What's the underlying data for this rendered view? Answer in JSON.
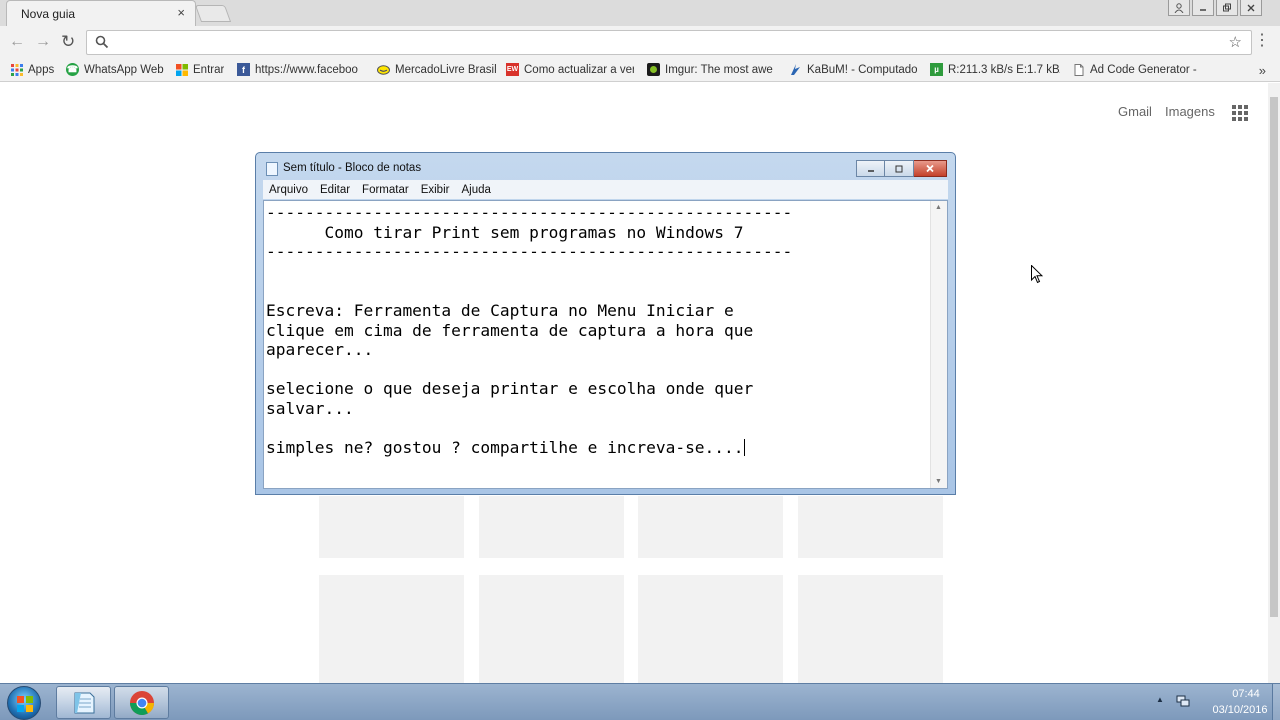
{
  "browser": {
    "tab_title": "Nova guia",
    "tab_close": "×",
    "omnibox_value": "",
    "bookmarks": [
      {
        "label": "Apps",
        "icon": "apps-grid-icon",
        "color": "#e8453c"
      },
      {
        "label": "WhatsApp Web",
        "icon": "whatsapp-icon",
        "color": "#25a244"
      },
      {
        "label": "Entrar",
        "icon": "microsoft-icon",
        "color": "#f25022"
      },
      {
        "label": "https://www.faceboo",
        "icon": "facebook-icon",
        "color": "#3b5998"
      },
      {
        "label": "MercadoLivre Brasil",
        "icon": "mercadolivre-icon",
        "color": "#7a7a7a"
      },
      {
        "label": "Como actualizar a ver",
        "icon": "ew-icon",
        "color": "#d8322b"
      },
      {
        "label": "Imgur: The most awe",
        "icon": "imgur-icon",
        "color": "#1b1b1b"
      },
      {
        "label": "KaBuM! - Computado",
        "icon": "kabum-icon",
        "color": "#2b66b3"
      },
      {
        "label": "R:211.3 kB/s E:1.7 kB/",
        "icon": "utorrent-icon",
        "color": "#2e9b3c"
      },
      {
        "label": "Ad Code Generator -",
        "icon": "page-icon",
        "color": "#888888"
      }
    ],
    "bookmarks_more": "»"
  },
  "newtab": {
    "gmail": "Gmail",
    "images": "Imagens"
  },
  "notepad": {
    "title": "Sem título - Bloco de notas",
    "menu": [
      "Arquivo",
      "Editar",
      "Formatar",
      "Exibir",
      "Ajuda"
    ],
    "lines": [
      "------------------------------------------------------",
      "      Como tirar Print sem programas no Windows 7",
      "------------------------------------------------------",
      "",
      "",
      "Escreva: Ferramenta de Captura no Menu Iniciar e",
      "clique em cima de ferramenta de captura a hora que",
      "aparecer...",
      "",
      "selecione o que deseja printar e escolha onde quer",
      "salvar...",
      "",
      "simples ne? gostou ? compartilhe e increva-se...."
    ]
  },
  "taskbar": {
    "time": "07:44",
    "date": "03/10/2016",
    "start_colors": [
      "#f35325",
      "#81bc06",
      "#05a6f0",
      "#ffba08"
    ]
  }
}
